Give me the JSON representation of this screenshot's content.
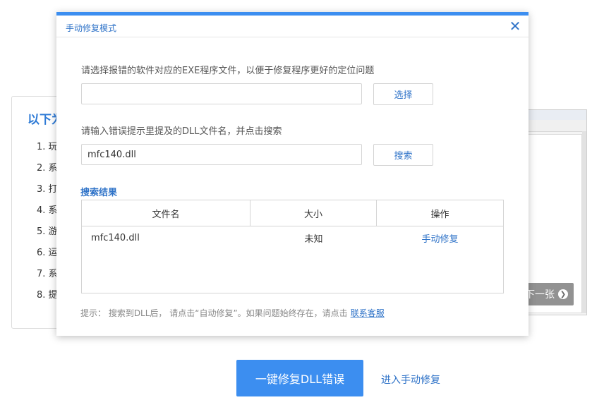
{
  "background": {
    "panel_title": "以下为",
    "list_items": [
      "1. 玩",
      "2. 系",
      "3. 打",
      "4. 系",
      "5. 游",
      "6. 运",
      "7. 系",
      "8. 提"
    ],
    "thumb_next_label": "下一张"
  },
  "dialog": {
    "title": "手动修复模式",
    "exe_prompt": "请选择报错的软件对应的EXE程序文件，以便于修复程序更好的定位问题",
    "exe_input_value": "",
    "choose_button": "选择",
    "dll_prompt": "请输入错误提示里提及的DLL文件名，并点击搜索",
    "dll_input_value": "mfc140.dll",
    "search_button": "搜索",
    "results_title": "搜索结果",
    "columns": {
      "filename": "文件名",
      "size": "大小",
      "action": "操作"
    },
    "rows": [
      {
        "filename": "mfc140.dll",
        "size": "未知",
        "action": "手动修复"
      }
    ],
    "hint_text": "提示： 搜索到DLL后， 请点击“自动修复”。如果问题始终存在，请点击",
    "hint_link": "联系客服"
  },
  "footer": {
    "primary_button": "一键修复DLL错误",
    "manual_link": "进入手动修复"
  },
  "colors": {
    "accent": "#3c8ef0",
    "link": "#2f73c8"
  }
}
